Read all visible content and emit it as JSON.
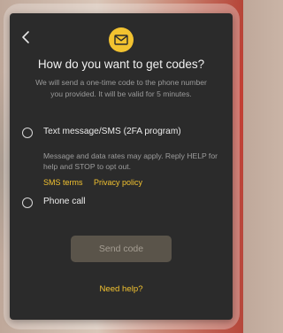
{
  "dialog": {
    "title": "How do you want to get codes?",
    "subtitle": "We will send a one-time code to the phone number you provided. It will be valid for 5 minutes.",
    "icons": {
      "back": "back-chevron-icon",
      "header": "mail-envelope-icon"
    }
  },
  "options": {
    "sms": {
      "label": "Text message/SMS (2FA program)",
      "description": "Message and data rates may apply. Reply HELP for help and STOP to opt out.",
      "selected": false
    },
    "phone": {
      "label": "Phone call",
      "selected": false
    }
  },
  "links": {
    "sms_terms": "SMS terms",
    "privacy_policy": "Privacy policy"
  },
  "actions": {
    "send_code": "Send code",
    "need_help": "Need help?"
  },
  "colors": {
    "accent": "#f2c230",
    "modal_bg": "#2b2b2b",
    "button_disabled_bg": "#5a544a"
  }
}
